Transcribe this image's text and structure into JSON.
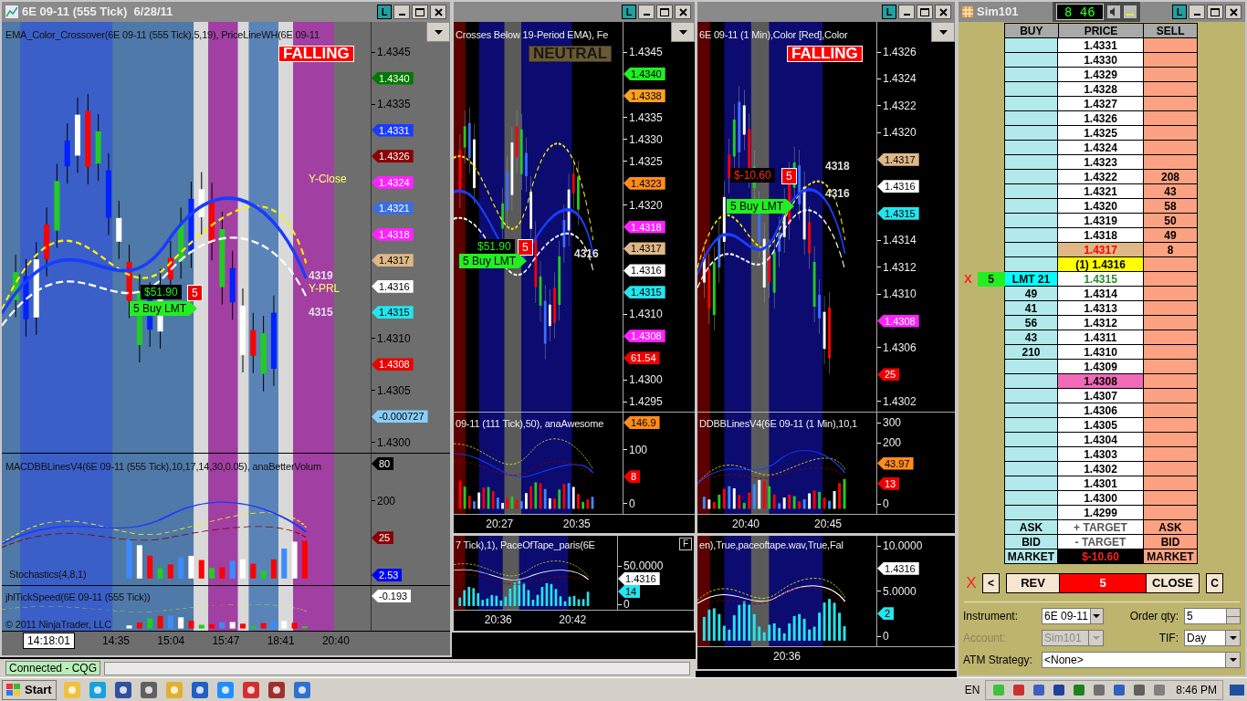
{
  "charts": [
    {
      "title_bar": true,
      "title": "6E 09-11 (555 Tick)  6/28/11",
      "link_button": "L",
      "panels": [
        {
          "kind": "price",
          "annotations": [
            {
              "text": "EMA_Color_Crossover(6E 09-11 (555 Tick),5,19), PriceLineWH(6E 09-11",
              "kind": "caption"
            },
            {
              "text": "FALLING",
              "kind": "falling"
            },
            {
              "text": "Y-Close",
              "kind": "level"
            },
            {
              "text": "4319",
              "kind": "price"
            },
            {
              "text": "Y-PRL",
              "kind": "level"
            },
            {
              "text": "4315",
              "kind": "price"
            },
            {
              "text": "$51.90",
              "kind": "pnl"
            },
            {
              "text": "5",
              "kind": "qty"
            },
            {
              "text": "5  Buy LMT",
              "kind": "order"
            }
          ],
          "axis": [
            {
              "text": "1.4345",
              "kind": "tick"
            },
            {
              "text": "1.4340",
              "kind": "flag",
              "color": "#007a00"
            },
            {
              "text": "1.4335",
              "kind": "tick"
            },
            {
              "text": "1.4331",
              "kind": "flag",
              "color": "#1a3cff"
            },
            {
              "text": "1.4326",
              "kind": "flag",
              "color": "#8b0000"
            },
            {
              "text": "1.4324",
              "kind": "flag",
              "color": "#ff22ff"
            },
            {
              "text": "1.4321",
              "kind": "flag",
              "color": "#3b6fe0"
            },
            {
              "text": "1.4318",
              "kind": "flag",
              "color": "#ff22ff"
            },
            {
              "text": "1.4317",
              "kind": "flag",
              "color": "#deb887"
            },
            {
              "text": "1.4316",
              "kind": "flag",
              "color": "#ffffff"
            },
            {
              "text": "1.4315",
              "kind": "flag",
              "color": "#22e5ee"
            },
            {
              "text": "1.4310",
              "kind": "tick"
            },
            {
              "text": "1.4308",
              "kind": "flag",
              "color": "#ee0000"
            },
            {
              "text": "1.4305",
              "kind": "tick"
            },
            {
              "text": "-0.000727",
              "kind": "flag",
              "color": "#87cefa"
            },
            {
              "text": "1.4300",
              "kind": "tick"
            }
          ]
        },
        {
          "kind": "indicator",
          "annotations": [
            {
              "text": "MACDBBLinesV4(6E 09-11 (555 Tick),10,17,14,30,0.05), anaBetterVolum",
              "kind": "caption"
            },
            {
              "text": "Stochastics(4,8,1)",
              "kind": "caption"
            }
          ],
          "axis": [
            {
              "text": "80",
              "kind": "flag",
              "color": "#000000"
            },
            {
              "text": "200",
              "kind": "tick"
            },
            {
              "text": "25",
              "kind": "flag",
              "color": "#8b0000"
            },
            {
              "text": "2.53",
              "kind": "flag",
              "color": "#0000ff"
            }
          ]
        },
        {
          "kind": "speed",
          "annotations": [
            {
              "text": "jhlTickSpeed(6E 09-11 (555 Tick))",
              "kind": "caption"
            },
            {
              "text": "© 2011 NinjaTrader, LLC",
              "kind": "caption"
            }
          ],
          "axis": [
            {
              "text": "-0.193",
              "kind": "flag",
              "color": "#ffffff"
            }
          ]
        }
      ],
      "time_axis": [
        {
          "text": "14:18:01",
          "kind": "cursor"
        },
        {
          "text": "14:35",
          "kind": "tick"
        },
        {
          "text": "15:04",
          "kind": "tick"
        },
        {
          "text": "15:47",
          "kind": "tick"
        },
        {
          "text": "18:41",
          "kind": "tick"
        },
        {
          "text": "20:40",
          "kind": "tick"
        }
      ]
    },
    {
      "title_bar": true,
      "link_button": "L",
      "panels": [
        {
          "kind": "price",
          "annotations": [
            {
              "text": "Crosses Below 19-Period EMA), Fe",
              "kind": "caption"
            },
            {
              "text": "NEUTRAL",
              "kind": "neutral"
            },
            {
              "text": "$51.90",
              "kind": "pnl"
            },
            {
              "text": "5",
              "kind": "qty"
            },
            {
              "text": "5  Buy LMT",
              "kind": "order"
            },
            {
              "text": "4316",
              "kind": "price"
            }
          ],
          "axis": [
            {
              "text": "1.4345",
              "kind": "tick"
            },
            {
              "text": "1.4340",
              "kind": "flag",
              "color": "#22ee22"
            },
            {
              "text": "1.4338",
              "kind": "flag",
              "color": "#ffa020"
            },
            {
              "text": "1.4335",
              "kind": "tick"
            },
            {
              "text": "1.4330",
              "kind": "tick"
            },
            {
              "text": "1.4325",
              "kind": "tick"
            },
            {
              "text": "1.4323",
              "kind": "flag",
              "color": "#ff8c1a"
            },
            {
              "text": "1.4320",
              "kind": "tick"
            },
            {
              "text": "1.4318",
              "kind": "flag",
              "color": "#ff22ff"
            },
            {
              "text": "1.4317",
              "kind": "flag",
              "color": "#deb887"
            },
            {
              "text": "1.4316",
              "kind": "flag",
              "color": "#ffffff"
            },
            {
              "text": "1.4315",
              "kind": "flag",
              "color": "#22e5ee"
            },
            {
              "text": "1.4310",
              "kind": "tick"
            },
            {
              "text": "1.4308",
              "kind": "flag",
              "color": "#ff22ff"
            },
            {
              "text": "61.54",
              "kind": "flag",
              "color": "#ee0000"
            },
            {
              "text": "1.4300",
              "kind": "tick"
            },
            {
              "text": "1.4295",
              "kind": "tick"
            }
          ]
        },
        {
          "kind": "indicator",
          "annotations": [
            {
              "text": "09-11 (111 Tick),50), anaAwesome",
              "kind": "caption"
            }
          ],
          "axis": [
            {
              "text": "146.9",
              "kind": "flag",
              "color": "#ff8c1a"
            },
            {
              "text": "100",
              "kind": "tick"
            },
            {
              "text": "8",
              "kind": "flag",
              "color": "#ee0000"
            },
            {
              "text": "0",
              "kind": "tick"
            }
          ]
        }
      ],
      "time_axis": [
        {
          "text": "20:27",
          "kind": "tick"
        },
        {
          "text": "20:35",
          "kind": "tick"
        }
      ]
    },
    {
      "title_bar": true,
      "link_button": "L",
      "panels": [
        {
          "kind": "price",
          "annotations": [
            {
              "text": "6E 09-11 (1 Min),Color [Red],Color",
              "kind": "caption"
            },
            {
              "text": "FALLING",
              "kind": "falling"
            },
            {
              "text": "$-10.60",
              "kind": "loss"
            },
            {
              "text": "5",
              "kind": "qty"
            },
            {
              "text": "4318",
              "kind": "price"
            },
            {
              "text": "4316",
              "kind": "price"
            },
            {
              "text": "5  Buy LMT",
              "kind": "order"
            }
          ],
          "axis": [
            {
              "text": "1.4326",
              "kind": "tick"
            },
            {
              "text": "1.4324",
              "kind": "tick"
            },
            {
              "text": "1.4322",
              "kind": "tick"
            },
            {
              "text": "1.4320",
              "kind": "tick"
            },
            {
              "text": "1.4317",
              "kind": "flag",
              "color": "#deb887"
            },
            {
              "text": "1.4316",
              "kind": "flag",
              "color": "#ffffff"
            },
            {
              "text": "1.4315",
              "kind": "flag",
              "color": "#22e5ee"
            },
            {
              "text": "1.4314",
              "kind": "tick"
            },
            {
              "text": "1.4312",
              "kind": "tick"
            },
            {
              "text": "1.4310",
              "kind": "tick"
            },
            {
              "text": "1.4308",
              "kind": "flag",
              "color": "#ff22ff"
            },
            {
              "text": "1.4306",
              "kind": "tick"
            },
            {
              "text": "25",
              "kind": "flag",
              "color": "#ee0000"
            },
            {
              "text": "1.4302",
              "kind": "tick"
            }
          ]
        },
        {
          "kind": "indicator",
          "annotations": [
            {
              "text": "DDBBLinesV4(6E 09-11 (1 Min),10,1",
              "kind": "caption"
            }
          ],
          "axis": [
            {
              "text": "300",
              "kind": "tick"
            },
            {
              "text": "200",
              "kind": "tick"
            },
            {
              "text": "43.97",
              "kind": "flag",
              "color": "#ff8c1a"
            },
            {
              "text": "13",
              "kind": "flag",
              "color": "#ee0000"
            },
            {
              "text": "0",
              "kind": "tick"
            }
          ]
        }
      ],
      "time_axis": [
        {
          "text": "20:40",
          "kind": "tick"
        },
        {
          "text": "20:45",
          "kind": "tick"
        }
      ]
    },
    {
      "title_bar": false,
      "button": "F",
      "panels": [
        {
          "kind": "tape",
          "annotations": [
            {
              "text": "7 Tick),1), PaceOfTape_paris(6E",
              "kind": "caption"
            }
          ],
          "axis": [
            {
              "text": "50.0000",
              "kind": "tick"
            },
            {
              "text": "1.4316",
              "kind": "flag",
              "color": "#ffffff"
            },
            {
              "text": "14",
              "kind": "flag",
              "color": "#22e5ee"
            },
            {
              "text": "0",
              "kind": "tick"
            }
          ]
        }
      ],
      "time_axis": [
        {
          "text": "20:36",
          "kind": "tick"
        },
        {
          "text": "20:42",
          "kind": "tick"
        }
      ]
    },
    {
      "title_bar": false,
      "panels": [
        {
          "kind": "tape",
          "annotations": [
            {
              "text": "en),True,paceoftape.wav,True,Fal",
              "kind": "caption"
            }
          ],
          "axis": [
            {
              "text": "10.0000",
              "kind": "tick"
            },
            {
              "text": "1.4316",
              "kind": "flag",
              "color": "#ffffff"
            },
            {
              "text": "5.0000",
              "kind": "tick"
            },
            {
              "text": "2",
              "kind": "flag",
              "color": "#22e5ee"
            },
            {
              "text": "0",
              "kind": "tick"
            }
          ]
        }
      ],
      "time_axis": [
        {
          "text": "20:36",
          "kind": "tick"
        }
      ]
    }
  ],
  "status_bar": {
    "connection": "Connected - CQG"
  },
  "dom": {
    "title": "Sim101",
    "clock": "8 46",
    "link_button": "L",
    "columns": [
      "BUY",
      "PRICE",
      "SELL"
    ],
    "rows": [
      {
        "price": "1.4331",
        "kind": "normal"
      },
      {
        "price": "1.4330",
        "kind": "normal"
      },
      {
        "price": "1.4329",
        "kind": "normal"
      },
      {
        "price": "1.4328",
        "kind": "normal"
      },
      {
        "price": "1.4327",
        "kind": "normal"
      },
      {
        "price": "1.4326",
        "kind": "normal"
      },
      {
        "price": "1.4325",
        "kind": "normal"
      },
      {
        "price": "1.4324",
        "kind": "normal"
      },
      {
        "price": "1.4323",
        "kind": "normal"
      },
      {
        "price": "1.4322",
        "kind": "normal",
        "sell": "208"
      },
      {
        "price": "1.4321",
        "kind": "normal",
        "sell": "43"
      },
      {
        "price": "1.4320",
        "kind": "normal",
        "sell": "58"
      },
      {
        "price": "1.4319",
        "kind": "normal",
        "sell": "50"
      },
      {
        "price": "1.4318",
        "kind": "normal",
        "sell": "49"
      },
      {
        "price": "1.4317",
        "kind": "last",
        "sell": "8"
      },
      {
        "price": "(1) 1.4316",
        "kind": "position"
      },
      {
        "price": "1.4315",
        "kind": "bid",
        "order": {
          "cancel": "X",
          "qty": "5",
          "label": "LMT 21"
        }
      },
      {
        "price": "1.4314",
        "kind": "normal",
        "buy": "49"
      },
      {
        "price": "1.4313",
        "kind": "normal",
        "buy": "41"
      },
      {
        "price": "1.4312",
        "kind": "normal",
        "buy": "56"
      },
      {
        "price": "1.4311",
        "kind": "normal",
        "buy": "43"
      },
      {
        "price": "1.4310",
        "kind": "normal",
        "buy": "210"
      },
      {
        "price": "1.4309",
        "kind": "normal"
      },
      {
        "price": "1.4308",
        "kind": "stop"
      },
      {
        "price": "1.4307",
        "kind": "normal"
      },
      {
        "price": "1.4306",
        "kind": "normal"
      },
      {
        "price": "1.4305",
        "kind": "normal"
      },
      {
        "price": "1.4304",
        "kind": "normal"
      },
      {
        "price": "1.4303",
        "kind": "normal"
      },
      {
        "price": "1.4302",
        "kind": "normal"
      },
      {
        "price": "1.4301",
        "kind": "normal"
      },
      {
        "price": "1.4300",
        "kind": "normal"
      },
      {
        "price": "1.4299",
        "kind": "normal"
      }
    ],
    "footer_rows": [
      {
        "buy": "ASK",
        "price": "+ TARGET",
        "sell": "ASK",
        "kind": "target"
      },
      {
        "buy": "BID",
        "price": "- TARGET",
        "sell": "BID",
        "kind": "target"
      },
      {
        "buy": "MARKET",
        "price": "$-10.60",
        "sell": "MARKET",
        "kind": "pnl"
      }
    ],
    "actions": [
      {
        "text": "X",
        "kind": "cancel"
      },
      {
        "text": "<",
        "kind": "small"
      },
      {
        "text": "REV",
        "kind": "wide"
      },
      {
        "text": "5",
        "kind": "position"
      },
      {
        "text": "CLOSE",
        "kind": "wide"
      },
      {
        "text": "C",
        "kind": "small"
      }
    ],
    "form": [
      {
        "label": "Instrument:",
        "value": "6E 09-11",
        "kind": "dropdown",
        "disabled": false
      },
      {
        "label": "Order qty:",
        "value": "5",
        "kind": "spinner",
        "disabled": false
      },
      {
        "label": "Account:",
        "value": "Sim101",
        "kind": "dropdown",
        "disabled": true
      },
      {
        "label": "TIF:",
        "value": "Day",
        "kind": "dropdown",
        "disabled": false
      },
      {
        "label": "ATM Strategy:",
        "value": "<None>",
        "kind": "wide_dropdown",
        "disabled": false
      }
    ]
  },
  "taskbar": {
    "start": "Start",
    "language": "EN",
    "clock": "8:46 PM"
  }
}
